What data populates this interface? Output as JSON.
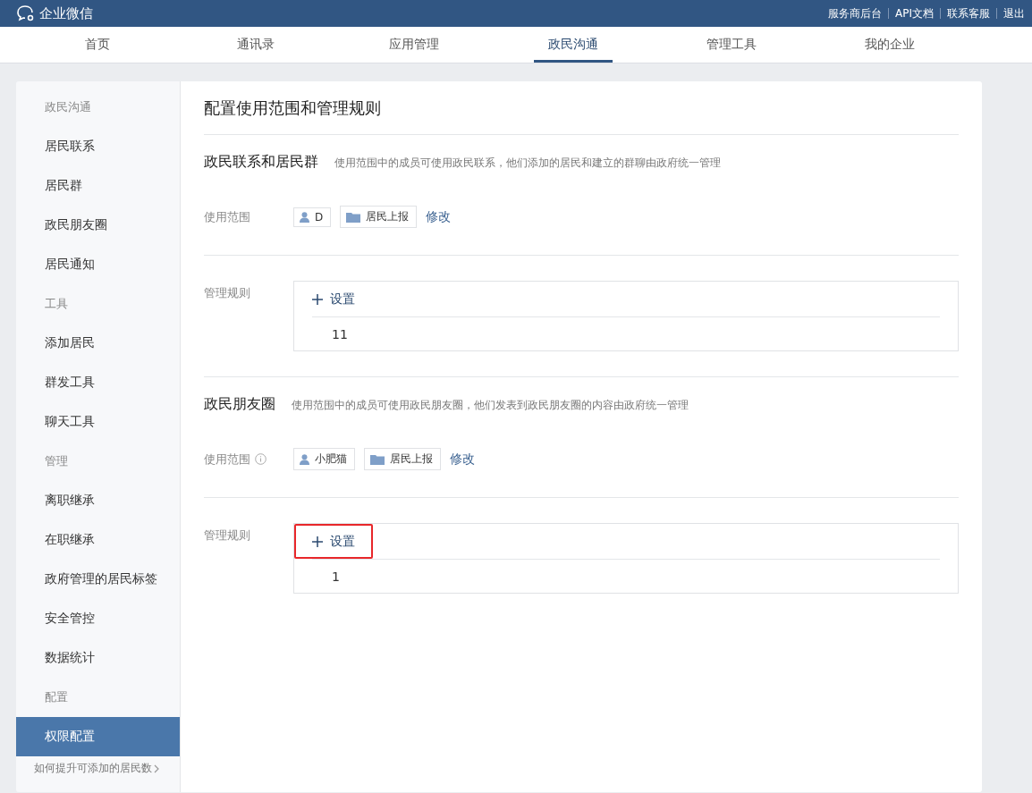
{
  "header": {
    "logo_text": "企业微信",
    "links": [
      "服务商后台",
      "API文档",
      "联系客服",
      "退出"
    ]
  },
  "nav": [
    {
      "label": "首页",
      "selected": false
    },
    {
      "label": "通讯录",
      "selected": false
    },
    {
      "label": "应用管理",
      "selected": false
    },
    {
      "label": "政民沟通",
      "selected": true
    },
    {
      "label": "管理工具",
      "selected": false
    },
    {
      "label": "我的企业",
      "selected": false
    }
  ],
  "sidebar": {
    "groups": [
      {
        "heading": "政民沟通",
        "items": [
          {
            "label": "居民联系",
            "selected": false
          },
          {
            "label": "居民群",
            "selected": false
          },
          {
            "label": "政民朋友圈",
            "selected": false
          },
          {
            "label": "居民通知",
            "selected": false
          }
        ]
      },
      {
        "heading": "工具",
        "items": [
          {
            "label": "添加居民",
            "selected": false
          },
          {
            "label": "群发工具",
            "selected": false
          },
          {
            "label": "聊天工具",
            "selected": false
          }
        ]
      },
      {
        "heading": "管理",
        "items": [
          {
            "label": "离职继承",
            "selected": false
          },
          {
            "label": "在职继承",
            "selected": false
          },
          {
            "label": "政府管理的居民标签",
            "selected": false
          },
          {
            "label": "安全管控",
            "selected": false
          },
          {
            "label": "数据统计",
            "selected": false
          }
        ]
      },
      {
        "heading": "配置",
        "items": [
          {
            "label": "权限配置",
            "selected": true
          }
        ]
      }
    ],
    "footer_link": "如何提升可添加的居民数"
  },
  "main": {
    "title": "配置使用范围和管理规则",
    "sections": [
      {
        "title": "政民联系和居民群",
        "description": "使用范围中的成员可使用政民联系，他们添加的居民和建立的群聊由政府统一管理",
        "scope_label": "使用范围",
        "scope_info": false,
        "members": [
          {
            "kind": "user",
            "label": "D"
          },
          {
            "kind": "department",
            "label": "居民上报"
          }
        ],
        "edit_link": "修改",
        "rules_label": "管理规则",
        "rule_button": "设置",
        "rule_button_highlighted": false,
        "rules": [
          "11"
        ]
      },
      {
        "title": "政民朋友圈",
        "description": "使用范围中的成员可使用政民朋友圈，他们发表到政民朋友圈的内容由政府统一管理",
        "scope_label": "使用范围",
        "scope_info": true,
        "members": [
          {
            "kind": "user",
            "label": "小肥猫"
          },
          {
            "kind": "department",
            "label": "居民上报"
          }
        ],
        "edit_link": "修改",
        "rules_label": "管理规则",
        "rule_button": "设置",
        "rule_button_highlighted": true,
        "rules": [
          "1"
        ]
      }
    ]
  }
}
